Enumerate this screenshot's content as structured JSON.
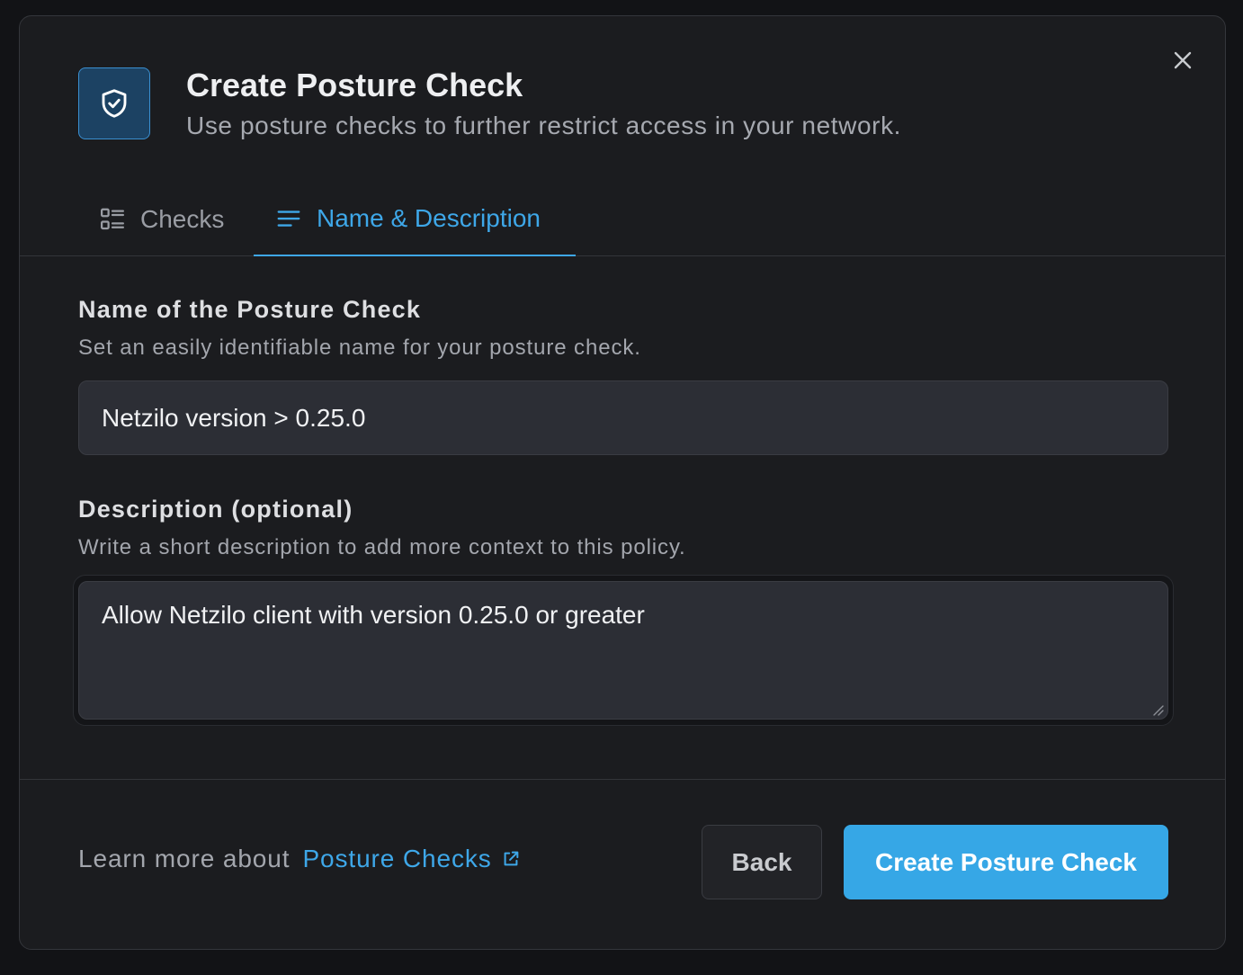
{
  "dialog": {
    "title": "Create Posture Check",
    "subtitle": "Use posture checks to further restrict access in your network.",
    "header_icon": "shield-check-icon",
    "close_icon": "close-icon"
  },
  "tabs": [
    {
      "label": "Checks",
      "icon": "checklist-icon",
      "active": false
    },
    {
      "label": "Name & Description",
      "icon": "text-lines-icon",
      "active": true
    }
  ],
  "form": {
    "name": {
      "label": "Name of the Posture Check",
      "help": "Set an easily identifiable name for your posture check.",
      "value": "Netzilo version > 0.25.0"
    },
    "description": {
      "label": "Description (optional)",
      "help": "Write a short description to add more context to this policy.",
      "value": "Allow Netzilo client with version 0.25.0 or greater"
    }
  },
  "footer": {
    "learn_prefix": "Learn more about",
    "learn_link": "Posture Checks",
    "learn_link_icon": "external-link-icon",
    "back_label": "Back",
    "create_label": "Create Posture Check"
  },
  "colors": {
    "accent": "#36a7e6",
    "modal_bg": "#1b1c1f",
    "input_bg": "#2c2e35"
  }
}
